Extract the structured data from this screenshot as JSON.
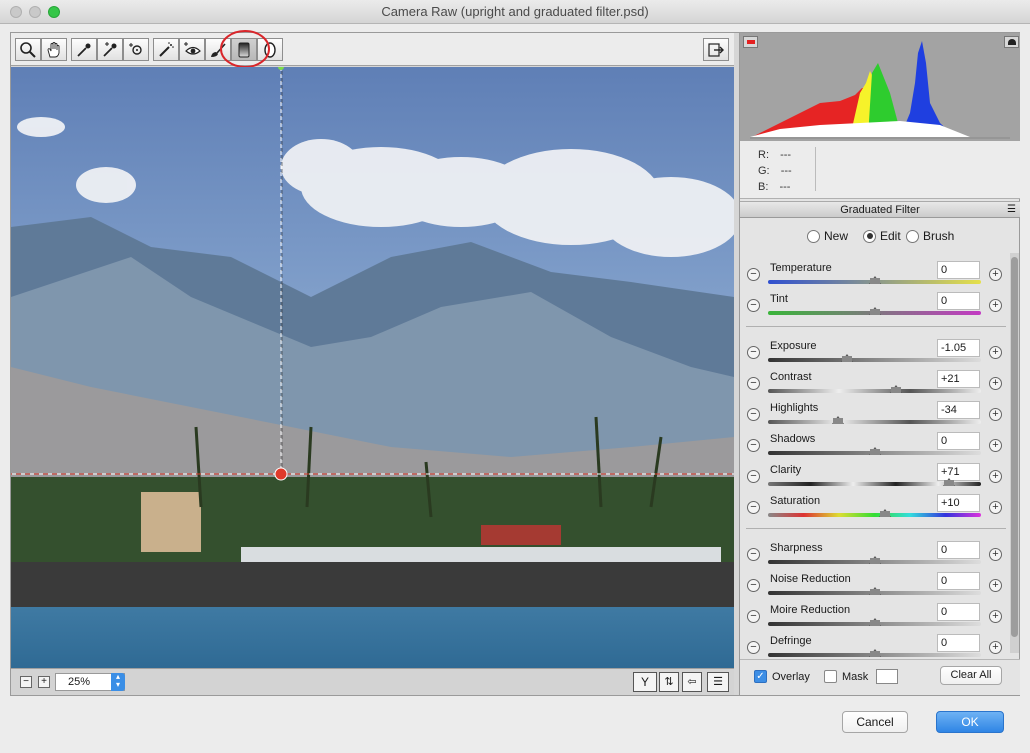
{
  "window": {
    "title": "Camera Raw (upright and graduated filter.psd)"
  },
  "toolbar": {
    "tools": [
      "zoom-icon",
      "hand-icon",
      "white-balance-icon",
      "color-sampler-icon",
      "targeted-adjustment-icon",
      "spot-removal-icon",
      "red-eye-icon",
      "adjustment-brush-icon",
      "graduated-filter-icon",
      "radial-filter-icon"
    ],
    "active": "graduated-filter-icon"
  },
  "histogram": {
    "r": "R:",
    "g": "G:",
    "b": "B:",
    "r_val": "---",
    "g_val": "---",
    "b_val": "---"
  },
  "panel": {
    "title": "Graduated Filter",
    "modes": [
      "New",
      "Edit",
      "Brush"
    ],
    "selected_mode": "Edit",
    "groups": [
      [
        {
          "label": "Temperature",
          "value": "0",
          "level": 0.5
        },
        {
          "label": "Tint",
          "value": "0",
          "level": 0.5
        }
      ],
      [
        {
          "label": "Exposure",
          "value": "-1.05",
          "level": 0.37
        },
        {
          "label": "Contrast",
          "value": "+21",
          "level": 0.6
        },
        {
          "label": "Highlights",
          "value": "-34",
          "level": 0.33
        },
        {
          "label": "Shadows",
          "value": "0",
          "level": 0.5
        },
        {
          "label": "Clarity",
          "value": "+71",
          "level": 0.85
        },
        {
          "label": "Saturation",
          "value": "+10",
          "level": 0.55
        }
      ],
      [
        {
          "label": "Sharpness",
          "value": "0",
          "level": 0.5
        },
        {
          "label": "Noise Reduction",
          "value": "0",
          "level": 0.5
        },
        {
          "label": "Moire Reduction",
          "value": "0",
          "level": 0.5
        },
        {
          "label": "Defringe",
          "value": "0",
          "level": 0.5
        }
      ]
    ]
  },
  "footer": {
    "overlay": "Overlay",
    "mask": "Mask",
    "clear_all": "Clear All",
    "overlay_checked": true,
    "mask_checked": false
  },
  "zoom": {
    "value": "25%"
  },
  "dialog": {
    "cancel": "Cancel",
    "ok": "OK"
  },
  "colors": {
    "accent": "#3a8ee6",
    "pin": "#e03a2a",
    "annotation": "#d9262b"
  }
}
